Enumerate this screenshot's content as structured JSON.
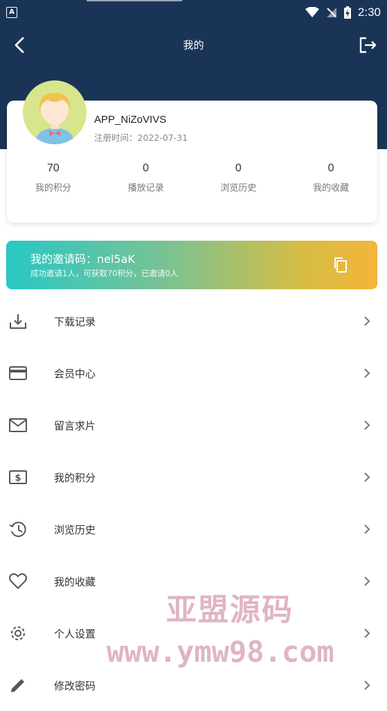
{
  "status_bar": {
    "time": "2:30",
    "notification_icon": "A"
  },
  "header": {
    "title": "我的"
  },
  "profile": {
    "username": "APP_NiZoVIVS",
    "register_label": "注册时间：2022-07-31"
  },
  "stats": [
    {
      "value": "70",
      "label": "我的积分"
    },
    {
      "value": "0",
      "label": "播放记录"
    },
    {
      "value": "0",
      "label": "浏览历史"
    },
    {
      "value": "0",
      "label": "我的收藏"
    }
  ],
  "invite": {
    "code_text": "我的邀请码：nel5aK",
    "desc": "成功邀请1人，可获取70积分，已邀请0人"
  },
  "menu": [
    {
      "label": "下载记录",
      "icon": "download-icon"
    },
    {
      "label": "会员中心",
      "icon": "card-icon"
    },
    {
      "label": "留言求片",
      "icon": "mail-icon"
    },
    {
      "label": "我的积分",
      "icon": "dollar-icon"
    },
    {
      "label": "浏览历史",
      "icon": "history-icon"
    },
    {
      "label": "我的收藏",
      "icon": "heart-icon"
    },
    {
      "label": "个人设置",
      "icon": "settings-icon"
    },
    {
      "label": "修改密码",
      "icon": "pencil-icon"
    }
  ],
  "watermark": {
    "line1": "亚盟源码",
    "line2": "www.ymw98.com"
  },
  "colors": {
    "header": "#1a3457",
    "invite_start": "#28c7c6",
    "invite_end": "#f4b53b"
  }
}
